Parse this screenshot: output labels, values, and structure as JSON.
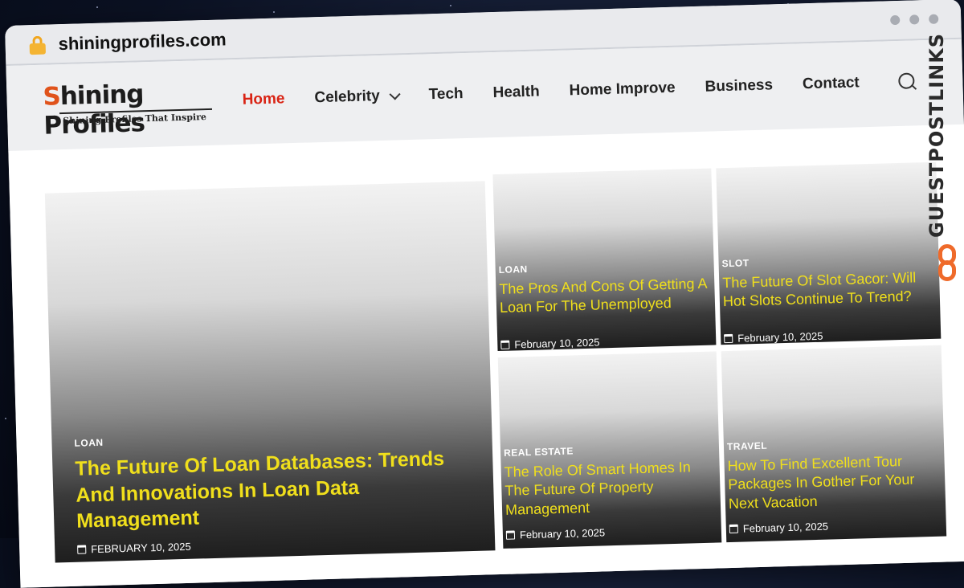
{
  "browser": {
    "url": "shiningprofiles.com"
  },
  "site": {
    "logo": {
      "first_letter": "S",
      "rest": "hining Profiles",
      "tagline": "Shining Profiles That Inspire"
    },
    "nav": [
      {
        "label": "Home",
        "active": true
      },
      {
        "label": "Celebrity",
        "has_dropdown": true
      },
      {
        "label": "Tech"
      },
      {
        "label": "Health"
      },
      {
        "label": "Home Improve"
      },
      {
        "label": "Business"
      },
      {
        "label": "Contact"
      }
    ]
  },
  "posts": {
    "featured": {
      "category": "LOAN",
      "title": "The Future Of Loan Databases: Trends And Innovations In Loan Data Management",
      "date": "FEBRUARY 10, 2025"
    },
    "grid": [
      {
        "category": "LOAN",
        "title": "The Pros And Cons Of Getting A Loan For The Unemployed",
        "date": "February 10, 2025"
      },
      {
        "category": "SLOT",
        "title": "The Future Of Slot Gacor: Will Hot Slots Continue To Trend?",
        "date": "February 10, 2025"
      },
      {
        "category": "REAL ESTATE",
        "title": "The Role Of Smart Homes In The Future Of Property Management",
        "date": "February 10, 2025"
      },
      {
        "category": "TRAVEL",
        "title": "How To Find Excellent Tour Packages In Gother For Your Next Vacation",
        "date": "February 10, 2025"
      }
    ]
  },
  "watermark": {
    "text": "GUESTPOSTLINKS",
    "accent": "#ef6a2a"
  },
  "colors": {
    "active_nav": "#d92415",
    "headline": "#f0df1c",
    "logo_accent": "#e0531b"
  }
}
